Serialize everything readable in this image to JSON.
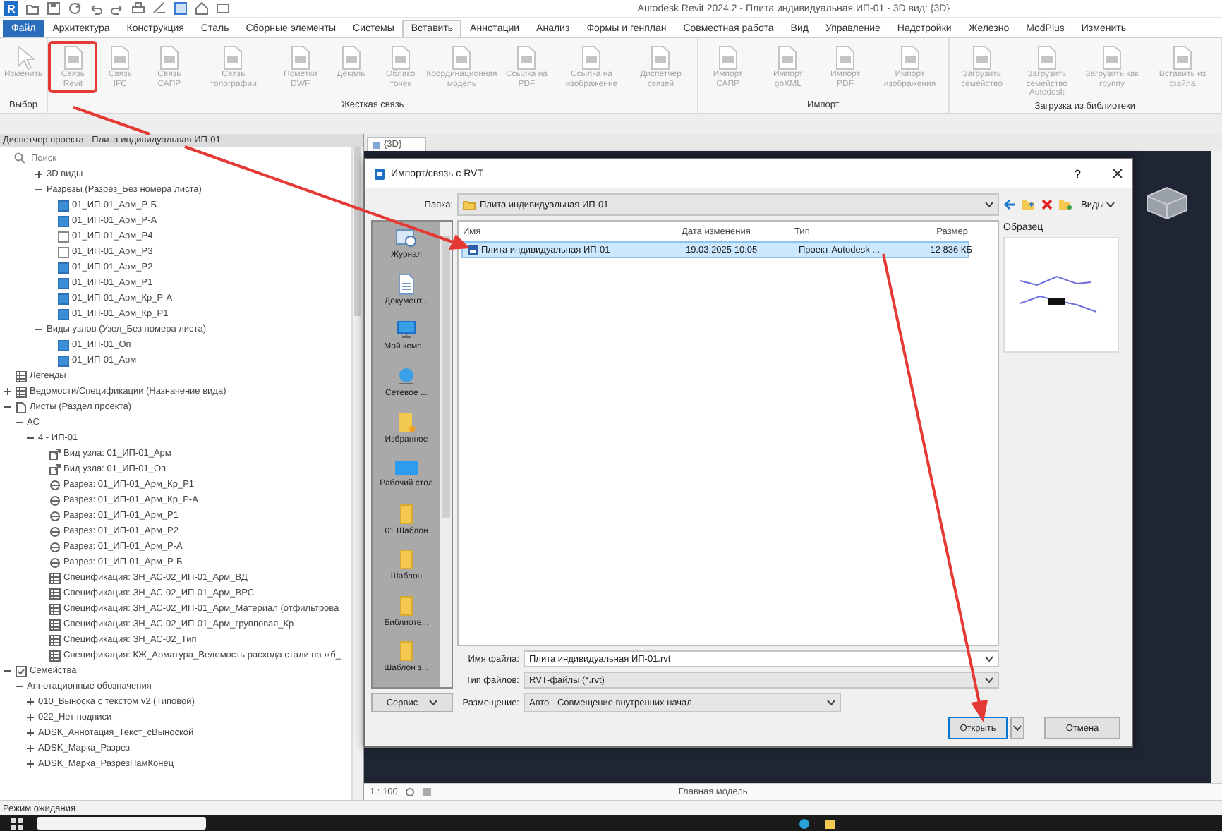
{
  "window": {
    "logo": "R",
    "title": "Autodesk Revit 2024.2 - Плита индивидуальная ИП-01 - 3D вид: {3D}"
  },
  "menu_tabs": [
    {
      "label": "Файл",
      "kind": "file",
      "selected": false
    },
    {
      "label": "Архитектура",
      "kind": "tab",
      "selected": false
    },
    {
      "label": "Конструкция",
      "kind": "tab",
      "selected": false
    },
    {
      "label": "Сталь",
      "kind": "tab",
      "selected": false
    },
    {
      "label": "Сборные элементы",
      "kind": "tab",
      "selected": false
    },
    {
      "label": "Системы",
      "kind": "tab",
      "selected": false
    },
    {
      "label": "Вставить",
      "kind": "tab",
      "selected": true
    },
    {
      "label": "Аннотации",
      "kind": "tab",
      "selected": false
    },
    {
      "label": "Анализ",
      "kind": "tab",
      "selected": false
    },
    {
      "label": "Формы и генплан",
      "kind": "tab",
      "selected": false
    },
    {
      "label": "Совместная работа",
      "kind": "tab",
      "selected": false
    },
    {
      "label": "Вид",
      "kind": "tab",
      "selected": false
    },
    {
      "label": "Управление",
      "kind": "tab",
      "selected": false
    },
    {
      "label": "Надстройки",
      "kind": "tab",
      "selected": false
    },
    {
      "label": "Железно",
      "kind": "tab",
      "selected": false
    },
    {
      "label": "ModPlus",
      "kind": "tab",
      "selected": false
    },
    {
      "label": "Изменить",
      "kind": "tab",
      "selected": false
    }
  ],
  "ribbon": {
    "panels": [
      {
        "label": "Выбор",
        "buttons": [
          {
            "label": "Изменить",
            "kind": "select",
            "disabled": true,
            "highlighted": false
          }
        ]
      },
      {
        "label": "Жесткая связь",
        "buttons": [
          {
            "label": "Связь Revit",
            "kind": "command",
            "disabled": true,
            "highlighted": true
          },
          {
            "label": "Связь IFC",
            "kind": "command",
            "disabled": true,
            "highlighted": false
          },
          {
            "label": "Связь САПР",
            "kind": "command",
            "disabled": true,
            "highlighted": false
          },
          {
            "label": "Связь топографии",
            "kind": "command",
            "disabled": true,
            "highlighted": false
          },
          {
            "label": "Пометки DWF",
            "kind": "command",
            "disabled": true,
            "highlighted": false
          },
          {
            "label": "Декаль",
            "kind": "command",
            "disabled": true,
            "highlighted": false
          },
          {
            "label": "Облако точек",
            "kind": "command",
            "disabled": true,
            "highlighted": false
          },
          {
            "label": "Координационная модель",
            "kind": "command",
            "disabled": true,
            "highlighted": false
          },
          {
            "label": "Ссылка на PDF",
            "kind": "command",
            "disabled": true,
            "highlighted": false
          },
          {
            "label": "Ссылка на изображение",
            "kind": "command",
            "disabled": true,
            "highlighted": false
          },
          {
            "label": "Диспетчер связей",
            "kind": "command",
            "disabled": true,
            "highlighted": false
          }
        ]
      },
      {
        "label": "Импорт",
        "buttons": [
          {
            "label": "Импорт САПР",
            "kind": "command",
            "disabled": true,
            "highlighted": false
          },
          {
            "label": "Импорт gbXML",
            "kind": "command",
            "disabled": true,
            "highlighted": false
          },
          {
            "label": "Импорт PDF",
            "kind": "command",
            "disabled": true,
            "highlighted": false
          },
          {
            "label": "Импорт изображения",
            "kind": "command",
            "disabled": true,
            "highlighted": false
          }
        ]
      },
      {
        "label": "Загрузка из библиотеки",
        "buttons": [
          {
            "label": "Загрузить семейство",
            "kind": "command",
            "disabled": true,
            "highlighted": false
          },
          {
            "label": "Загрузить семейство Autodesk",
            "kind": "command",
            "disabled": true,
            "highlighted": false
          },
          {
            "label": "Загрузить как группу",
            "kind": "command",
            "disabled": true,
            "highlighted": false
          },
          {
            "label": "Вставить из файла",
            "kind": "command",
            "disabled": true,
            "highlighted": false
          }
        ]
      }
    ]
  },
  "project_browser": {
    "title": "Диспетчер проекта - Плита индивидуальная ИП-01",
    "search": {
      "placeholder": "Поиск"
    },
    "view_nodes": [
      {
        "label": "3D виды",
        "expanded": false
      },
      {
        "label": "Разрезы (Разрез_Без номера листа)",
        "expanded": true,
        "children": [
          {
            "label": "01_ИП-01_Арм_Р-Б",
            "kind": "view",
            "on_sheet": true
          },
          {
            "label": "01_ИП-01_Арм_Р-А",
            "kind": "view",
            "on_sheet": true
          },
          {
            "label": "01_ИП-01_Арм_Р4",
            "kind": "view",
            "on_sheet": false
          },
          {
            "label": "01_ИП-01_Арм_Р3",
            "kind": "view",
            "on_sheet": false
          },
          {
            "label": "01_ИП-01_Арм_Р2",
            "kind": "view",
            "on_sheet": true
          },
          {
            "label": "01_ИП-01_Арм_Р1",
            "kind": "view",
            "on_sheet": true
          },
          {
            "label": "01_ИП-01_Арм_Кр_Р-А",
            "kind": "view",
            "on_sheet": true
          },
          {
            "label": "01_ИП-01_Арм_Кр_Р1",
            "kind": "view",
            "on_sheet": true
          }
        ]
      },
      {
        "label": "Виды узлов (Узел_Без номера листа)",
        "expanded": true,
        "children": [
          {
            "label": "01_ИП-01_Оп",
            "kind": "view",
            "on_sheet": true
          },
          {
            "label": "01_ИП-01_Арм",
            "kind": "view",
            "on_sheet": true
          }
        ]
      }
    ],
    "tree": [
      {
        "label": "Легенды",
        "kind": "legends"
      },
      {
        "label": "Ведомости/Спецификации (Назначение вида)",
        "kind": "schedules",
        "expanded": false
      },
      {
        "label": "Листы (Раздел проекта)",
        "kind": "sheets",
        "expanded": true,
        "children": [
          {
            "label": "АС",
            "expanded": true,
            "children": [
              {
                "label": "4 - ИП-01",
                "expanded": true,
                "children": [
                  {
                    "label": "Вид узла: 01_ИП-01_Арм",
                    "kind": "detail-ref"
                  },
                  {
                    "label": "Вид узла: 01_ИП-01_Оп",
                    "kind": "detail-ref"
                  },
                  {
                    "label": "Разрез: 01_ИП-01_Арм_Кр_Р1",
                    "kind": "section-ref"
                  },
                  {
                    "label": "Разрез: 01_ИП-01_Арм_Кр_Р-А",
                    "kind": "section-ref"
                  },
                  {
                    "label": "Разрез: 01_ИП-01_Арм_Р1",
                    "kind": "section-ref"
                  },
                  {
                    "label": "Разрез: 01_ИП-01_Арм_Р2",
                    "kind": "section-ref"
                  },
                  {
                    "label": "Разрез: 01_ИП-01_Арм_Р-А",
                    "kind": "section-ref"
                  },
                  {
                    "label": "Разрез: 01_ИП-01_Арм_Р-Б",
                    "kind": "section-ref"
                  },
                  {
                    "label": "Спецификация: ЗН_АС-02_ИП-01_Арм_ВД",
                    "kind": "schedule-ref"
                  },
                  {
                    "label": "Спецификация: ЗН_АС-02_ИП-01_Арм_ВРС",
                    "kind": "schedule-ref"
                  },
                  {
                    "label": "Спецификация: ЗН_АС-02_ИП-01_Арм_Материал (отфильтрова",
                    "kind": "schedule-ref"
                  },
                  {
                    "label": "Спецификация: ЗН_АС-02_ИП-01_Арм_групповая_Кр",
                    "kind": "schedule-ref"
                  },
                  {
                    "label": "Спецификация: ЗН_АС-02_Тип",
                    "kind": "schedule-ref"
                  },
                  {
                    "label": "Спецификация: КЖ_Арматура_Ведомость расхода стали на жб_",
                    "kind": "schedule-ref"
                  }
                ]
              }
            ]
          }
        ]
      },
      {
        "label": "Семейства",
        "kind": "families",
        "expanded": true,
        "children": [
          {
            "label": "Аннотационные обозначения",
            "expanded": true,
            "children": [
              {
                "label": "010_Выноска с текстом v2 (Типовой)",
                "expanded": false
              },
              {
                "label": "022_Нет подписи",
                "expanded": false
              },
              {
                "label": "ADSK_Аннотация_Текст_сВыноской",
                "expanded": false
              },
              {
                "label": "ADSK_Марка_Разрез",
                "expanded": false
              },
              {
                "label": "ADSK_Марка_РазрезПамКонец",
                "expanded": false
              }
            ]
          }
        ]
      }
    ]
  },
  "view_tab": {
    "label": "{3D}"
  },
  "dialog": {
    "title": "Импорт/связь с RVT",
    "help": "?",
    "folder": {
      "label": "Папка:",
      "value": "Плита индивидуальная ИП-01"
    },
    "views_button": "Виды",
    "places": [
      {
        "label": "Журнал",
        "kind": "history"
      },
      {
        "label": "Документ...",
        "kind": "documents"
      },
      {
        "label": "Мой комп...",
        "kind": "computer"
      },
      {
        "label": "Сетевое ...",
        "kind": "network"
      },
      {
        "label": "Избранное",
        "kind": "favorites"
      },
      {
        "label": "Рабочий стол",
        "kind": "desktop"
      },
      {
        "label": "01 Шаблон",
        "kind": "folder"
      },
      {
        "label": "Шаблон",
        "kind": "folder"
      },
      {
        "label": "Библиоте...",
        "kind": "folder"
      },
      {
        "label": "Шаблон з...",
        "kind": "folder"
      }
    ],
    "columns": [
      "Имя",
      "Дата изменения",
      "Тип",
      "Размер"
    ],
    "files": [
      {
        "cells": [
          "Плита индивидуальная ИП-01",
          "19.03.2025 10:05",
          "Проект Autodesk ...",
          "12 836 КБ"
        ],
        "selected": true
      }
    ],
    "preview": {
      "label": "Образец"
    },
    "file_name": {
      "label": "Имя файла:",
      "value": "Плита индивидуальная ИП-01.rvt"
    },
    "file_type": {
      "label": "Тип файлов:",
      "value": "RVT-файлы (*.rvt)"
    },
    "service_button": "Сервис",
    "placement": {
      "label": "Размещение:",
      "value": "Авто - Совмещение внутренних начал"
    },
    "open_button": "Открыть",
    "cancel_button": "Отмена"
  },
  "view_bar": {
    "scale": "1 : 100",
    "model": "Главная модель"
  },
  "status_bar": {
    "text": "Режим ожидания"
  }
}
